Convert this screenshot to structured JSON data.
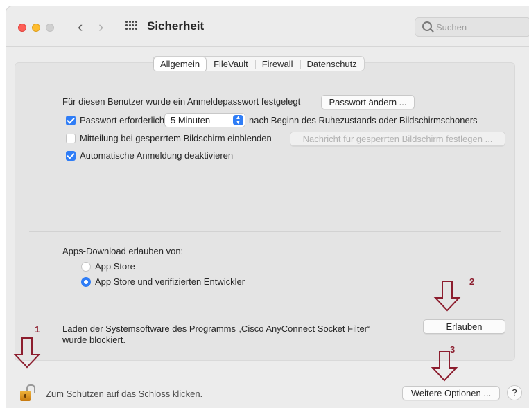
{
  "window": {
    "title": "Sicherheit",
    "search_placeholder": "Suchen"
  },
  "tabs": [
    {
      "label": "Allgemein",
      "active": true
    },
    {
      "label": "FileVault",
      "active": false
    },
    {
      "label": "Firewall",
      "active": false
    },
    {
      "label": "Datenschutz",
      "active": false
    }
  ],
  "general": {
    "password_info": "Für diesen Benutzer wurde ein Anmeldepasswort festgelegt",
    "change_password_button": "Passwort ändern ...",
    "require_password": {
      "label": "Passwort erforderlich",
      "checked": true
    },
    "delay_select": "5 Minuten",
    "delay_suffix": "nach Beginn des Ruhezustands oder Bildschirmschoners",
    "lock_message": {
      "label": "Mitteilung bei gesperrtem Bildschirm einblenden",
      "checked": false
    },
    "lock_message_button": "Nachricht für gesperrten Bildschirm festlegen ...",
    "disable_auto_login": {
      "label": "Automatische Anmeldung deaktivieren",
      "checked": true
    }
  },
  "downloads": {
    "heading": "Apps-Download erlauben von:",
    "options": [
      {
        "label": "App Store",
        "selected": false
      },
      {
        "label": "App Store und verifizierten Entwickler",
        "selected": true
      }
    ],
    "blocked_line1": "Laden der Systemsoftware des Programms „Cisco AnyConnect Socket Filter“",
    "blocked_line2": "wurde blockiert.",
    "allow_button": "Erlauben"
  },
  "footer": {
    "lock_text": "Zum Schützen auf das Schloss klicken.",
    "more_options_button": "Weitere Optionen ...",
    "help_button": "?"
  },
  "annotations": {
    "marker1": "1",
    "marker2": "2",
    "marker3": "3",
    "color": "#8c1d2e"
  },
  "colors": {
    "accent": "#2f7df6",
    "close": "#fe5f57",
    "minimize": "#febc2e"
  }
}
